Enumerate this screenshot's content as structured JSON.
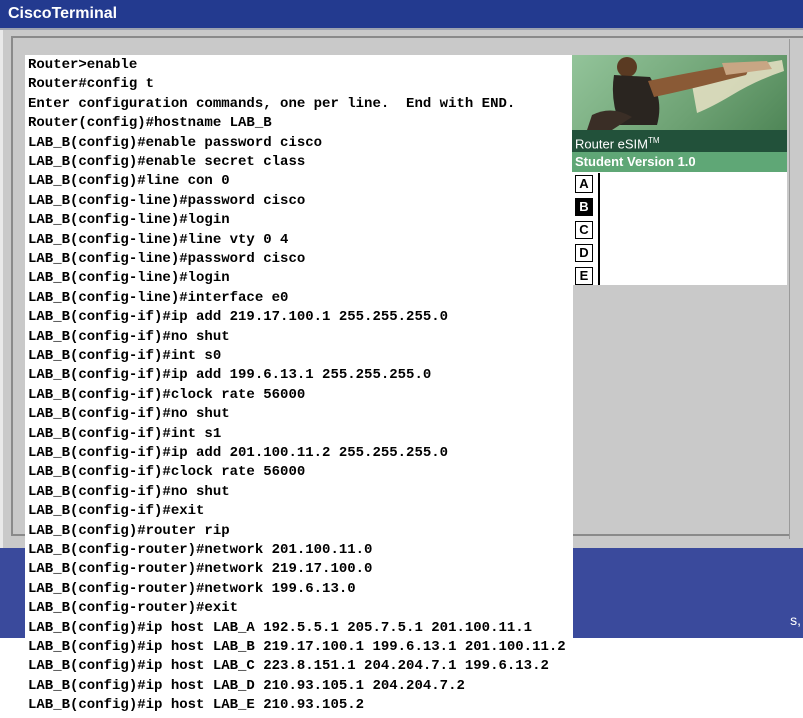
{
  "window": {
    "title": "CiscoTerminal"
  },
  "terminal": {
    "lines": [
      "Router>enable",
      "Router#config t",
      "Enter configuration commands, one per line.  End with END.",
      "Router(config)#hostname LAB_B",
      "LAB_B(config)#enable password cisco",
      "LAB_B(config)#enable secret class",
      "LAB_B(config)#line con 0",
      "LAB_B(config-line)#password cisco",
      "LAB_B(config-line)#login",
      "LAB_B(config-line)#line vty 0 4",
      "LAB_B(config-line)#password cisco",
      "LAB_B(config-line)#login",
      "LAB_B(config-line)#interface e0",
      "LAB_B(config-if)#ip add 219.17.100.1 255.255.255.0",
      "LAB_B(config-if)#no shut",
      "LAB_B(config-if)#int s0",
      "LAB_B(config-if)#ip add 199.6.13.1 255.255.255.0",
      "LAB_B(config-if)#clock rate 56000",
      "LAB_B(config-if)#no shut",
      "LAB_B(config-if)#int s1",
      "LAB_B(config-if)#ip add 201.100.11.2 255.255.255.0",
      "LAB_B(config-if)#clock rate 56000",
      "LAB_B(config-if)#no shut",
      "LAB_B(config-if)#exit",
      "LAB_B(config)#router rip",
      "LAB_B(config-router)#network 201.100.11.0",
      "LAB_B(config-router)#network 219.17.100.0",
      "LAB_B(config-router)#network 199.6.13.0",
      "LAB_B(config-router)#exit",
      "LAB_B(config)#ip host LAB_A 192.5.5.1 205.7.5.1 201.100.11.1",
      "LAB_B(config)#ip host LAB_B 219.17.100.1 199.6.13.1 201.100.11.2",
      "LAB_B(config)#ip host LAB_C 223.8.151.1 204.204.7.1 199.6.13.2",
      "LAB_B(config)#ip host LAB_D 210.93.105.1 204.204.7.2",
      "LAB_B(config)#ip host LAB_E 210.93.105.2"
    ]
  },
  "panel": {
    "brand": "Router eSIM",
    "brand_tm": "TM",
    "version": "Student Version 1.0",
    "routers": [
      {
        "label": "A",
        "active": false
      },
      {
        "label": "B",
        "active": true
      },
      {
        "label": "C",
        "active": false
      },
      {
        "label": "D",
        "active": false
      },
      {
        "label": "E",
        "active": false
      }
    ]
  },
  "background": {
    "fragment": "s,"
  },
  "colors": {
    "titlebar": "#233a8f",
    "brand_bar": "#22513a",
    "version_bar": "#5fa776",
    "band": "#3a4a9c"
  }
}
